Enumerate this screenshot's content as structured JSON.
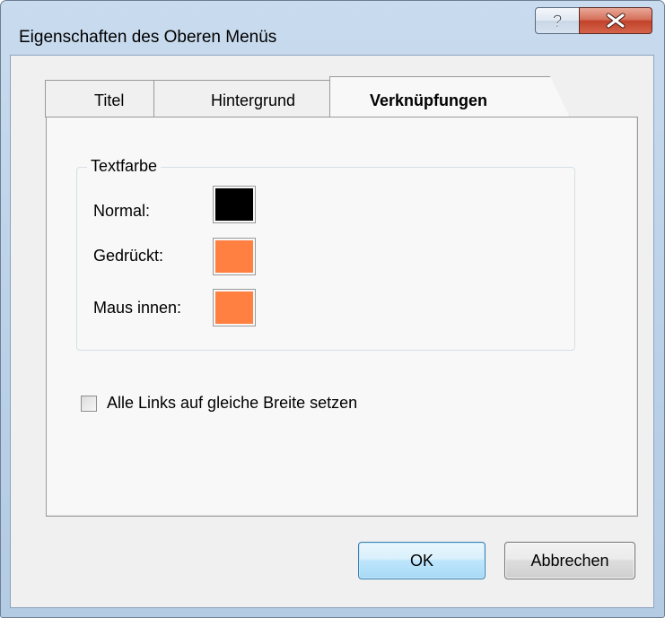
{
  "window": {
    "title": "Eigenschaften des Oberen Menüs",
    "help_glyph": "?",
    "close_glyph": "✕"
  },
  "tabs": [
    {
      "label": "Titel",
      "active": false
    },
    {
      "label": "Hintergrund",
      "active": false
    },
    {
      "label": "Verknüpfungen",
      "active": true
    }
  ],
  "text_color_group": {
    "legend": "Textfarbe",
    "rows": [
      {
        "label": "Normal:",
        "color": "#000000"
      },
      {
        "label": "Gedrückt:",
        "color": "#ff8040"
      },
      {
        "label": "Maus innen:",
        "color": "#ff8040"
      }
    ]
  },
  "equal_width_checkbox": {
    "label": "Alle Links auf gleiche Breite setzen",
    "checked": false
  },
  "buttons": {
    "ok": "OK",
    "cancel": "Abbrechen"
  }
}
